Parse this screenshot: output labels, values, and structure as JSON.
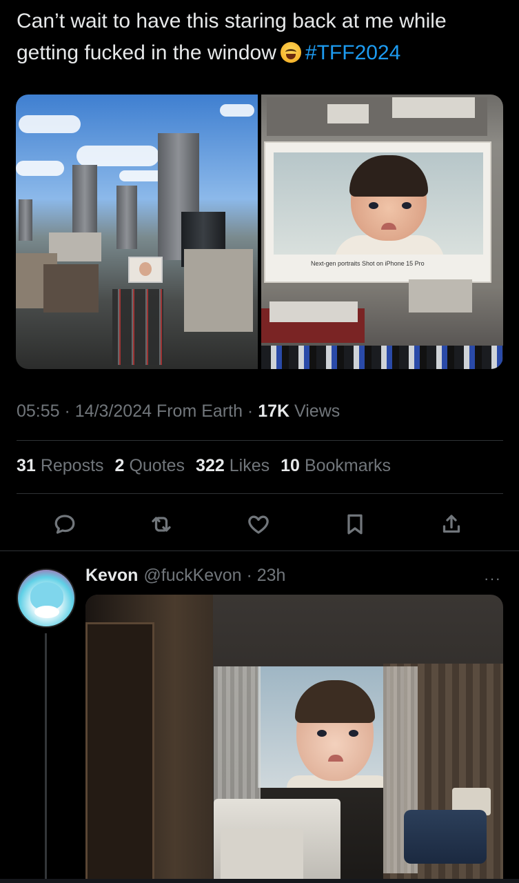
{
  "tweet": {
    "text": "Can’t wait to have this staring back at me while getting fucked in the window",
    "hashtag": "#TFF2024",
    "board_caption": "Next-gen portraits Shot on iPhone 15 Pro",
    "time": "05:55",
    "date": "14/3/2024",
    "source": "From Earth",
    "views_count": "17K",
    "views_label": "Views"
  },
  "stats": {
    "reposts_count": "31",
    "reposts_label": "Reposts",
    "quotes_count": "2",
    "quotes_label": "Quotes",
    "likes_count": "322",
    "likes_label": "Likes",
    "bookmarks_count": "10",
    "bookmarks_label": "Bookmarks"
  },
  "actions": [
    "reply-icon",
    "repost-icon",
    "like-icon",
    "bookmark-icon",
    "share-icon"
  ],
  "reply": {
    "name": "Kevon",
    "handle": "@fuckKevon",
    "time": "23h",
    "more": "···"
  },
  "colors": {
    "background": "#000000",
    "text": "#e7e9ea",
    "secondary": "#71767b",
    "accent": "#1d9bf0",
    "divider": "#2f3336"
  }
}
